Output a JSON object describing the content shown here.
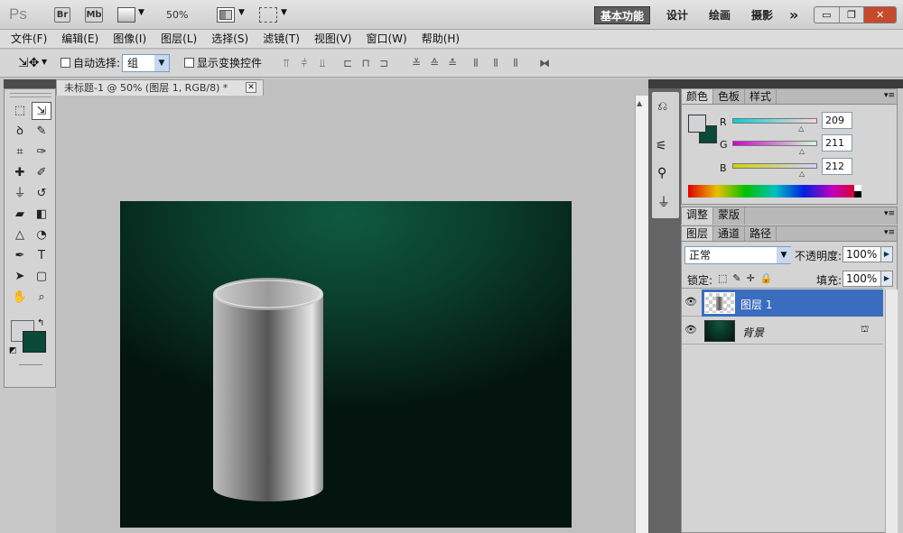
{
  "app": {
    "logo": "Ps",
    "bridge": "Br",
    "minibridge": "Mb",
    "zoom": "50%"
  },
  "workspaces": {
    "active": "基本功能",
    "others": [
      "设计",
      "绘画",
      "摄影"
    ],
    "more": "»"
  },
  "window_buttons": [
    "▭",
    "❐",
    "✕"
  ],
  "menu": [
    "文件(F)",
    "编辑(E)",
    "图像(I)",
    "图层(L)",
    "选择(S)",
    "滤镜(T)",
    "视图(V)",
    "窗口(W)",
    "帮助(H)"
  ],
  "options": {
    "auto_select_label": "自动选择:",
    "auto_select_value": "组",
    "show_transform_label": "显示变换控件"
  },
  "document": {
    "tab_title": "未标题-1 @ 50% (图层 1, RGB/8) *",
    "close": "✕"
  },
  "color_panel": {
    "tabs": [
      "颜色",
      "色板",
      "样式"
    ],
    "r_label": "R",
    "g_label": "G",
    "b_label": "B",
    "r": "209",
    "g": "211",
    "b": "212",
    "fg_color": "#d1d3d4",
    "bg_color": "#0a4a36",
    "r_frac": 0.82,
    "g_frac": 0.83,
    "b_frac": 0.83
  },
  "adjust_panel": {
    "tabs": [
      "调整",
      "蒙版"
    ]
  },
  "layers_panel": {
    "tabs": [
      "图层",
      "通道",
      "路径"
    ],
    "blend_mode": "正常",
    "opacity_label": "不透明度:",
    "opacity": "100%",
    "lock_label": "锁定:",
    "fill_label": "填充:",
    "fill": "100%",
    "layers": [
      {
        "name": "图层 1",
        "selected": true
      },
      {
        "name": "背景",
        "selected": false
      }
    ]
  }
}
